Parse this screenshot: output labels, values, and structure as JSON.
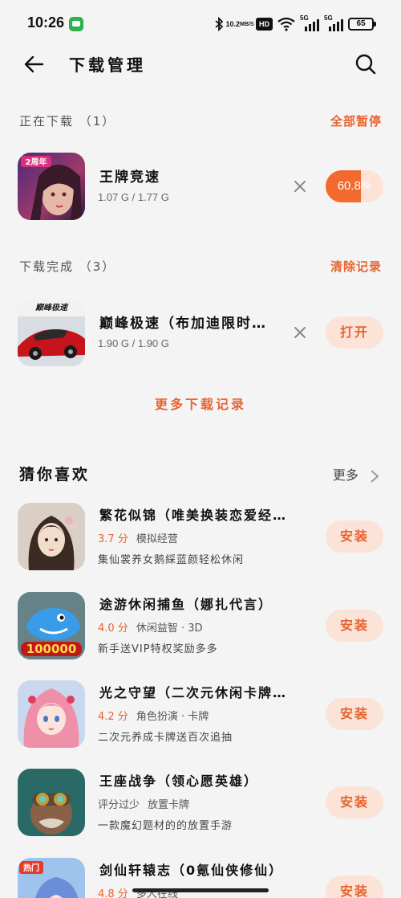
{
  "status": {
    "time": "10:26",
    "speed_top": "10.2",
    "speed_unit": "MB/S",
    "hd": "HD",
    "sig1": "5G",
    "sig2": "5G",
    "battery": "65"
  },
  "header": {
    "title": "下载管理"
  },
  "downloading": {
    "title": "正在下载 （1）",
    "action": "全部暂停",
    "items": [
      {
        "name": "王牌竞速",
        "size": "1.07 G / 1.77 G",
        "progress_text": "60.8%",
        "progress": 0.608
      }
    ]
  },
  "completed": {
    "title": "下载完成 （3）",
    "action": "清除记录",
    "items": [
      {
        "name": "巅峰极速（布加迪限时…",
        "size": "1.90 G / 1.90 G",
        "button": "打开"
      }
    ]
  },
  "more_records": "更多下载记录",
  "recommend": {
    "title": "猜你喜欢",
    "more": "更多",
    "items": [
      {
        "name": "繁花似锦（唯美换装恋爱经…",
        "rating": "3.7 分",
        "category": "模拟经营",
        "desc": "集仙裳养女鹅綵蓝颜轻松休闲",
        "button": "安装"
      },
      {
        "name": "途游休闲捕鱼（娜扎代言）",
        "rating": "4.0 分",
        "category": "休闲益智 · 3D",
        "desc": "新手送VIP特权奖励多多",
        "button": "安装"
      },
      {
        "name": "光之守望（二次元休闲卡牌…",
        "rating": "4.2 分",
        "category": "角色扮演 · 卡牌",
        "desc": "二次元养成卡牌送百次追抽",
        "button": "安装"
      },
      {
        "name": "王座战争（领心愿英雄）",
        "rating": "评分过少",
        "category": "放置卡牌",
        "desc": "一款魔幻题材的的放置手游",
        "button": "安装"
      },
      {
        "name": "剑仙轩辕志（0氪仙侠修仙）",
        "rating": "4.8 分",
        "category": "多人在线",
        "desc": "",
        "button": "安装"
      }
    ]
  },
  "icon_labels": {
    "wzjs": "2周年",
    "dfjs": "巅峰极速",
    "fish": "100000",
    "hot": "热门"
  },
  "colors": {
    "accent": "#e8632f",
    "accent_light": "#fbe3d8",
    "bg": "#f4f4f4"
  }
}
